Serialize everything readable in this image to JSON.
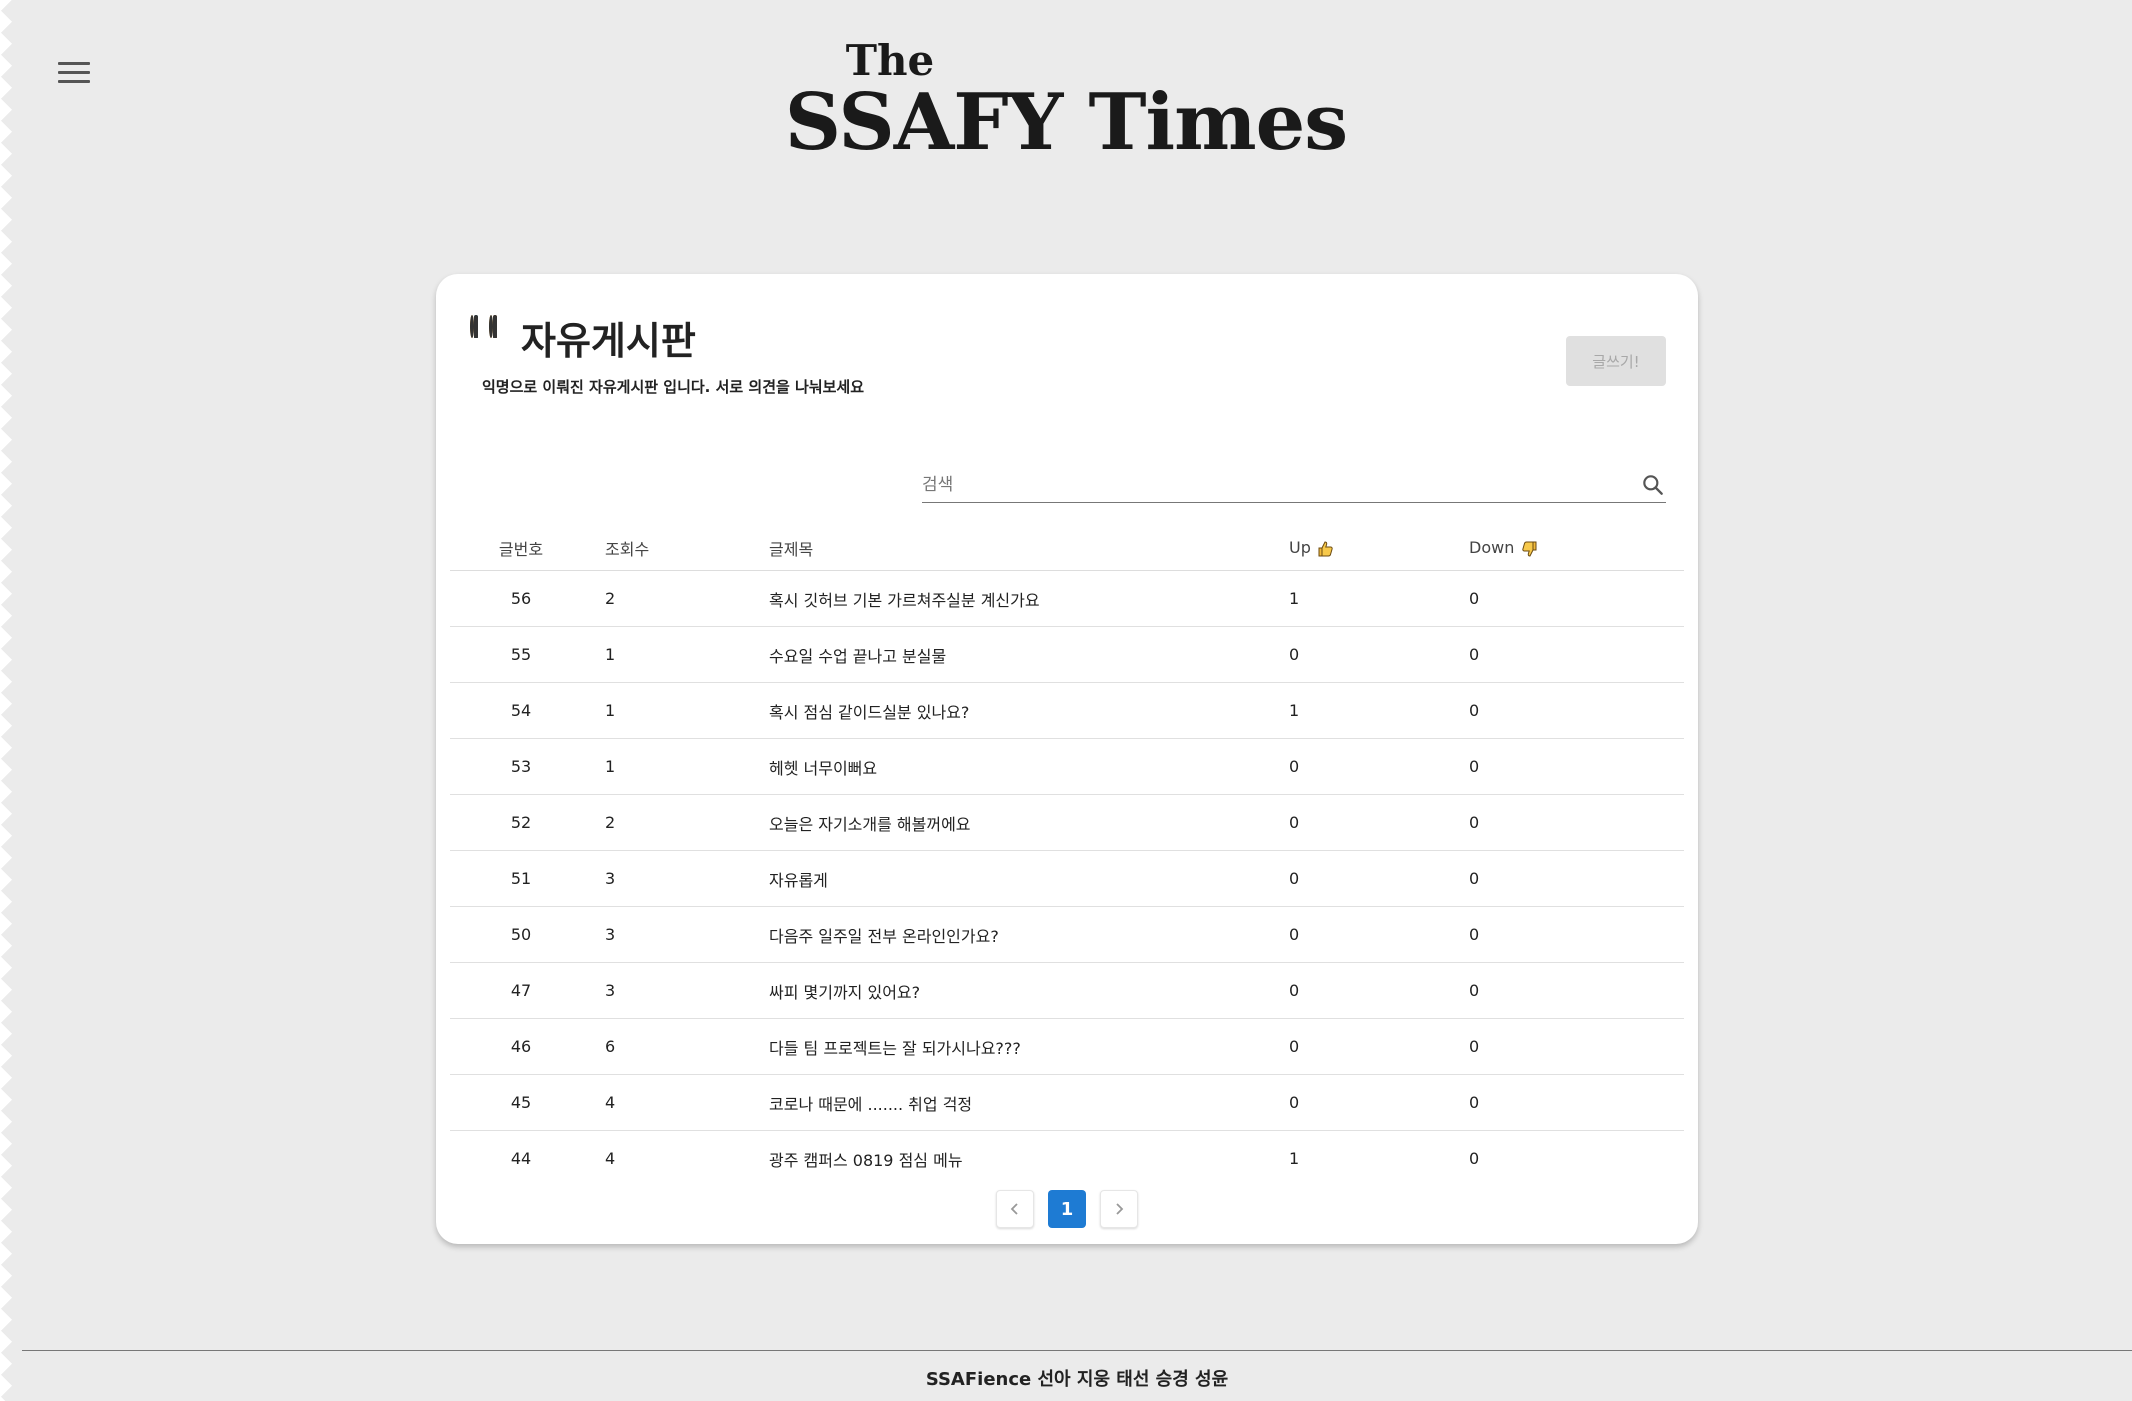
{
  "header": {
    "logo_top": "The",
    "logo_main": "SSAFY Times"
  },
  "board": {
    "title": "자유게시판",
    "title_icon": "two-people-icon",
    "subtitle": "익명으로 이뤄진 자유게시판 입니다. 서로 의견을 나눠보세요",
    "write_label": "글쓰기!",
    "search_placeholder": "검색"
  },
  "table": {
    "headers": {
      "num": "글번호",
      "views": "조회수",
      "title": "글제목",
      "up": "Up",
      "down": "Down"
    },
    "rows": [
      {
        "num": "56",
        "views": "2",
        "title": "혹시 깃허브 기본 가르쳐주실분 계신가요",
        "up": "1",
        "down": "0"
      },
      {
        "num": "55",
        "views": "1",
        "title": "수요일 수업 끝나고 분실물",
        "up": "0",
        "down": "0"
      },
      {
        "num": "54",
        "views": "1",
        "title": "혹시 점심 같이드실분 있나요?",
        "up": "1",
        "down": "0"
      },
      {
        "num": "53",
        "views": "1",
        "title": "헤헷 너무이뻐요",
        "up": "0",
        "down": "0"
      },
      {
        "num": "52",
        "views": "2",
        "title": "오늘은 자기소개를 해볼꺼에요",
        "up": "0",
        "down": "0"
      },
      {
        "num": "51",
        "views": "3",
        "title": "자유롭게",
        "up": "0",
        "down": "0"
      },
      {
        "num": "50",
        "views": "3",
        "title": "다음주 일주일 전부 온라인인가요?",
        "up": "0",
        "down": "0"
      },
      {
        "num": "47",
        "views": "3",
        "title": "싸피 몇기까지 있어요?",
        "up": "0",
        "down": "0"
      },
      {
        "num": "46",
        "views": "6",
        "title": "다들 팀 프로젝트는 잘 되가시나요???",
        "up": "0",
        "down": "0"
      },
      {
        "num": "45",
        "views": "4",
        "title": "코로나 때문에 ....... 취업 걱정",
        "up": "0",
        "down": "0"
      },
      {
        "num": "44",
        "views": "4",
        "title": "광주 캠퍼스 0819 점심 메뉴",
        "up": "1",
        "down": "0"
      }
    ]
  },
  "pagination": {
    "current": "1"
  },
  "footer": {
    "text": "SSAFience 선아 지웅 태선 승경 성윤"
  },
  "colors": {
    "background": "#ebebeb",
    "accent": "#1e7bd3",
    "card": "#ffffff"
  }
}
